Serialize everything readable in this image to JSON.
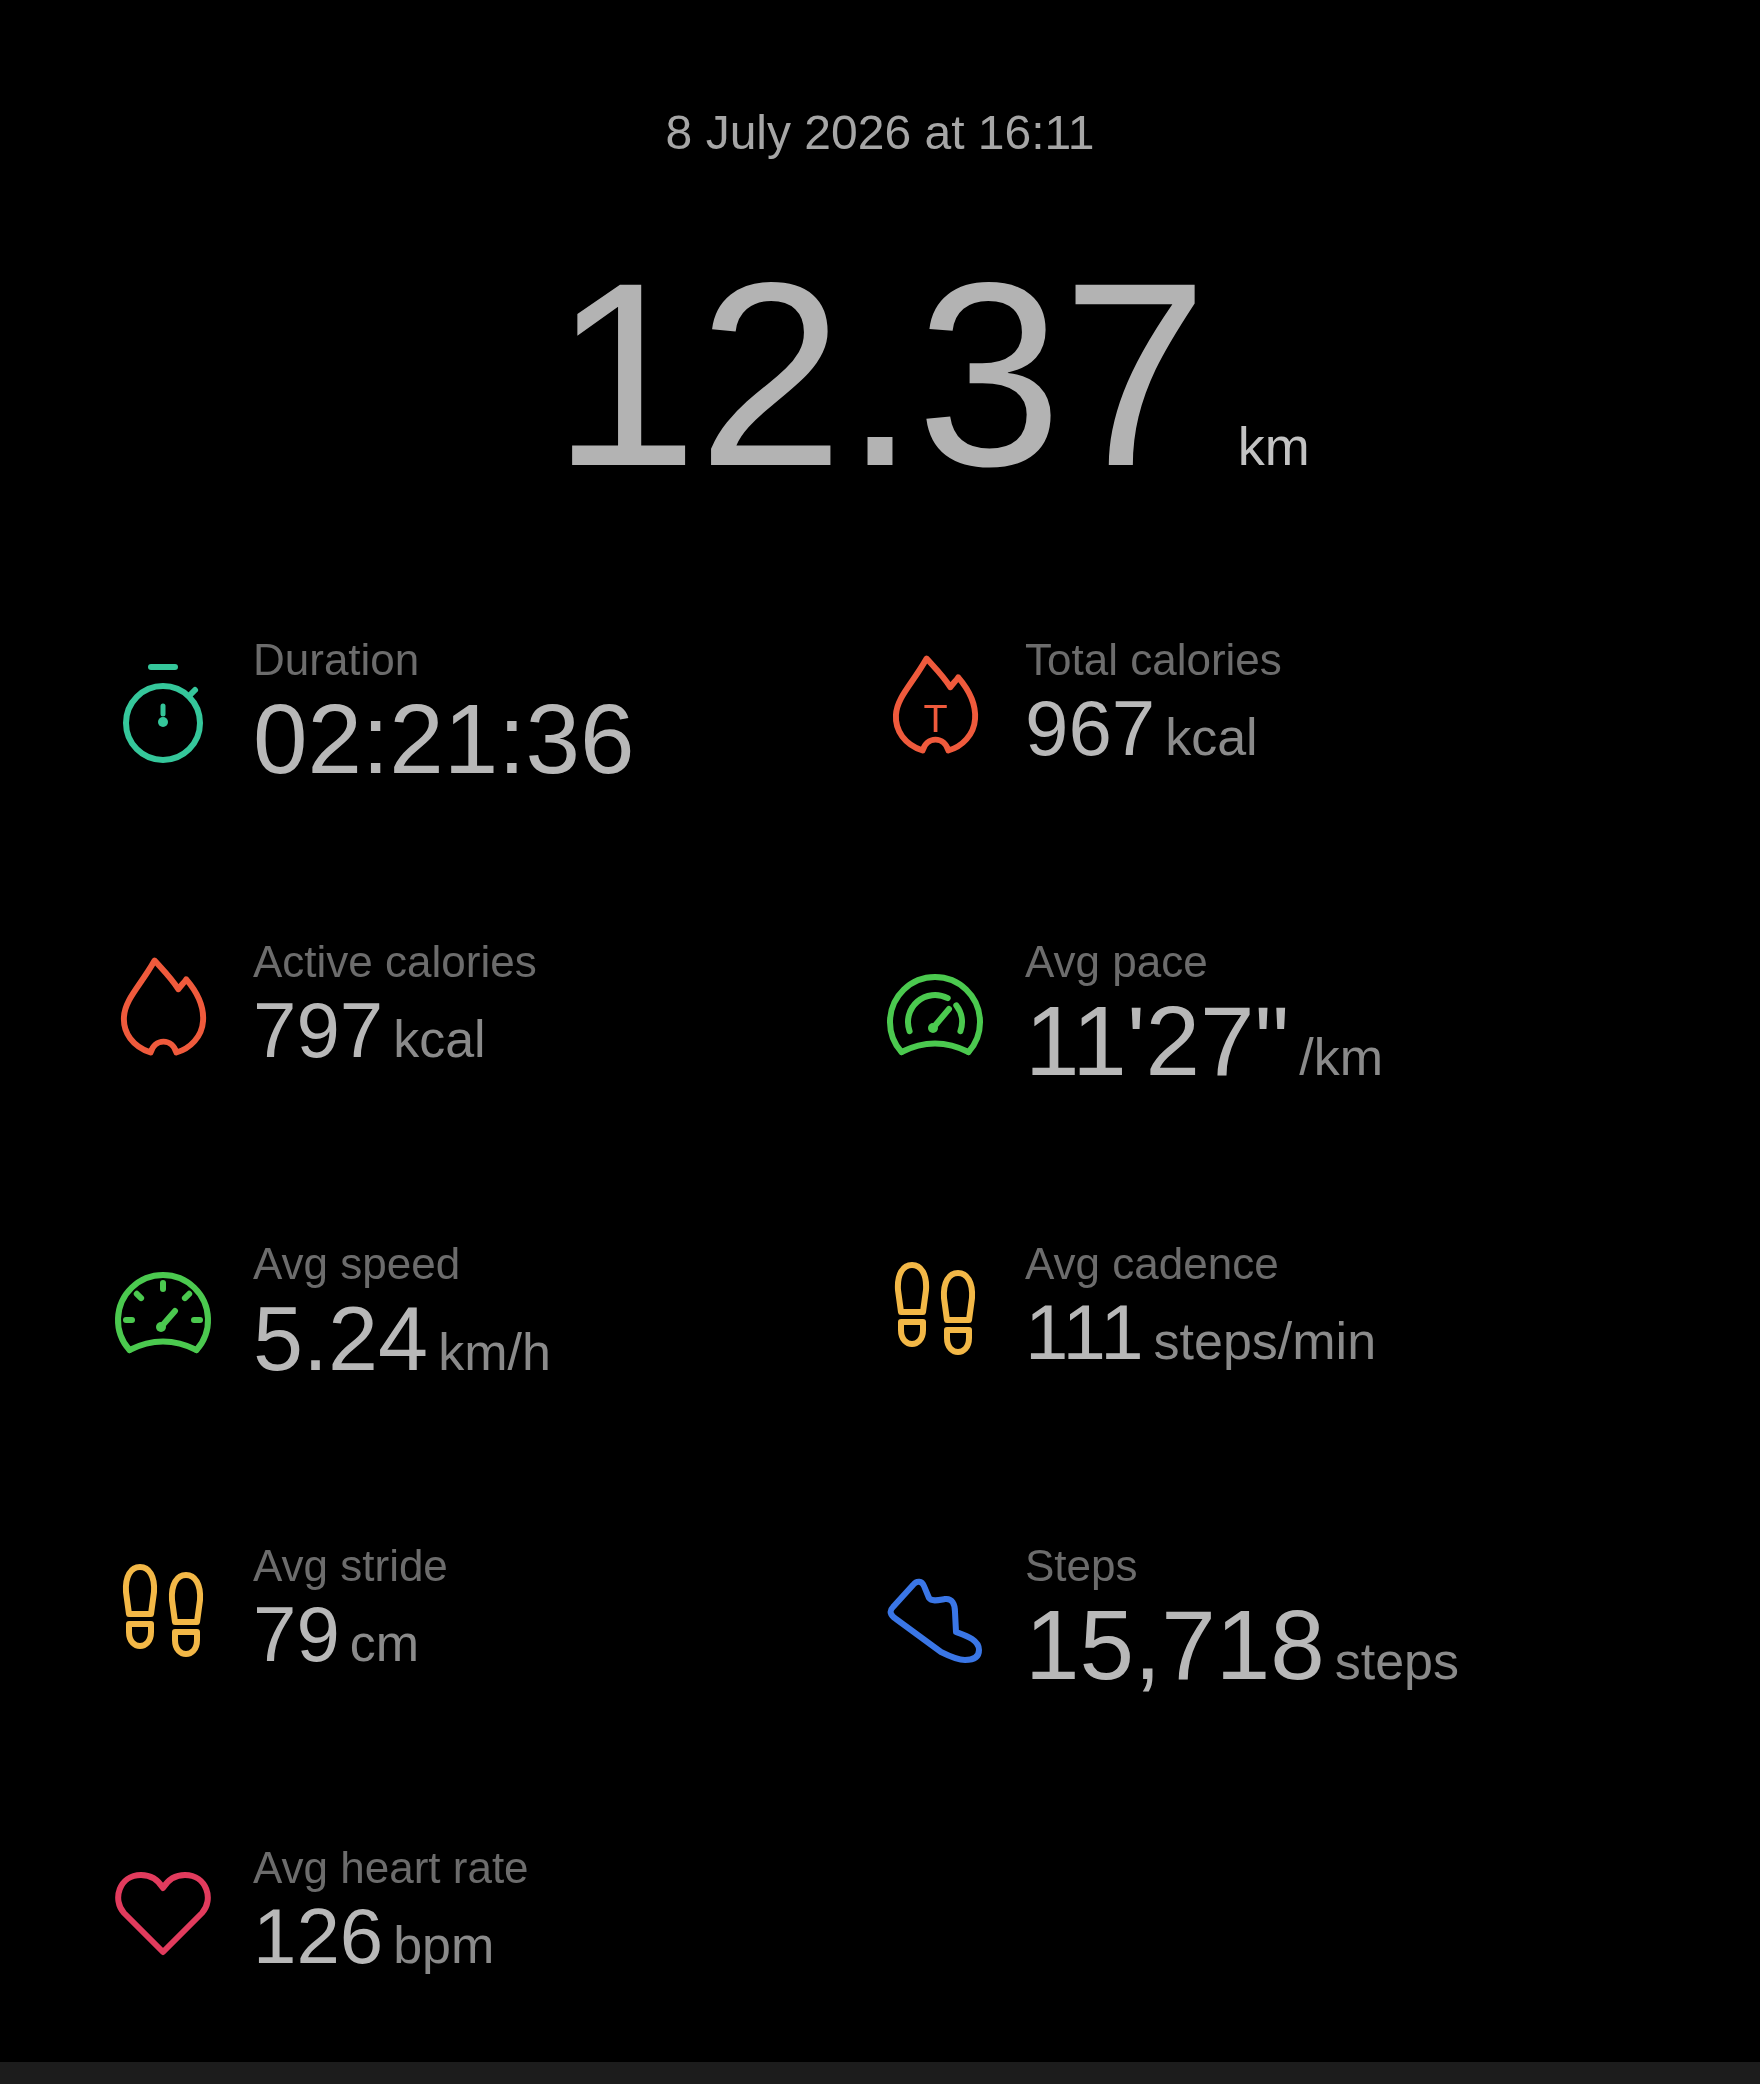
{
  "header": {
    "date": "8 July 2026 at 16:11"
  },
  "distance": {
    "value": "12.37",
    "unit": "km"
  },
  "stats": [
    {
      "kind": "duration",
      "label": "Duration",
      "value": "02:21:36"
    },
    {
      "kind": "totalcal",
      "label": "Total calories",
      "value": "967",
      "unit": "kcal",
      "icon_mark": "T"
    },
    {
      "kind": "activecal",
      "label": "Active calories",
      "value": "797",
      "unit": "kcal"
    },
    {
      "kind": "pace",
      "label": "Avg pace",
      "value": "11'27\"",
      "unit": "/km"
    },
    {
      "kind": "speed",
      "label": "Avg speed",
      "value": "5.24",
      "unit": "km/h"
    },
    {
      "kind": "cadence",
      "label": "Avg cadence",
      "value": "111",
      "unit": "steps/min"
    },
    {
      "kind": "stride",
      "label": "Avg stride",
      "value": "79",
      "unit": "cm"
    },
    {
      "kind": "steps",
      "label": "Steps",
      "value": "15,718",
      "unit": "steps"
    },
    {
      "kind": "heartrate",
      "label": "Avg heart rate",
      "value": "126",
      "unit": "bpm"
    }
  ]
}
